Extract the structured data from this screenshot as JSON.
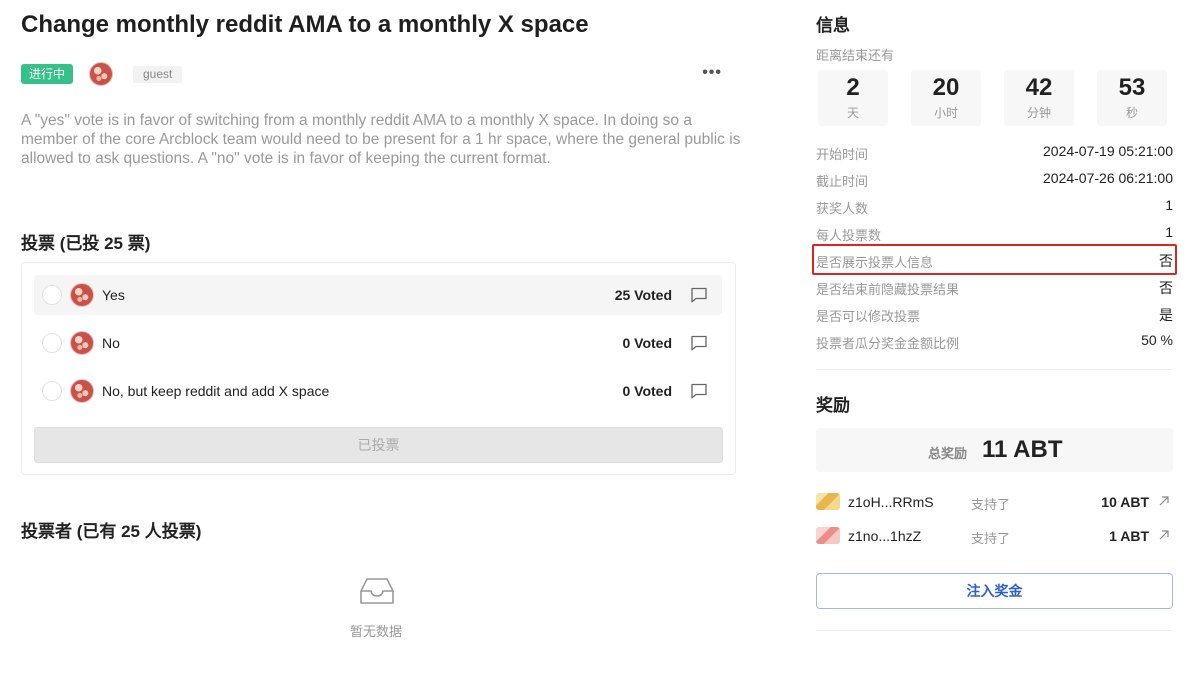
{
  "proposal": {
    "title": "Change monthly reddit AMA to a monthly X space",
    "status": "进行中",
    "author": "guest",
    "more": "•••",
    "description": "A \"yes\" vote is in favor of switching from a monthly reddit AMA to a monthly X space. In doing so a member of the core Arcblock team would need to be present for a 1 hr space, where the general public is allowed to ask questions. A \"no\" vote is in favor of keeping the current format."
  },
  "votes": {
    "heading": "投票 (已投 25 票)",
    "options": [
      {
        "label": "Yes",
        "count": "25 Voted"
      },
      {
        "label": "No",
        "count": "0 Voted"
      },
      {
        "label": "No, but keep reddit and add X space",
        "count": "0 Voted"
      }
    ],
    "submit_label": "已投票"
  },
  "voters": {
    "heading": "投票者 (已有 25 人投票)",
    "empty_text": "暂无数据"
  },
  "info": {
    "title": "信息",
    "countdown_label": "距离结束还有",
    "countdown": [
      {
        "value": "2",
        "unit": "天"
      },
      {
        "value": "20",
        "unit": "小时"
      },
      {
        "value": "42",
        "unit": "分钟"
      },
      {
        "value": "53",
        "unit": "秒"
      }
    ],
    "rows": [
      {
        "key": "开始时间",
        "value": "2024-07-19 05:21:00"
      },
      {
        "key": "截止时间",
        "value": "2024-07-26 06:21:00"
      },
      {
        "key": "获奖人数",
        "value": "1"
      },
      {
        "key": "每人投票数",
        "value": "1"
      },
      {
        "key": "是否展示投票人信息",
        "value": "否"
      },
      {
        "key": "是否结束前隐藏投票结果",
        "value": "否"
      },
      {
        "key": "是否可以修改投票",
        "value": "是"
      },
      {
        "key": "投票者瓜分奖金金额比例",
        "value": "50 %"
      }
    ]
  },
  "reward": {
    "title": "奖励",
    "total_label": "总奖励",
    "total_value": "11 ABT",
    "donors": [
      {
        "name": "z1oH...RRmS",
        "action": "支持了",
        "amount": "10 ABT"
      },
      {
        "name": "z1no...1hzZ",
        "action": "支持了",
        "amount": "1 ABT"
      }
    ],
    "inject_label": "注入奖金"
  },
  "colors": {
    "status_green": "#36c08a",
    "highlight_red": "#e02424",
    "accent_blue": "#2f5fcf"
  }
}
